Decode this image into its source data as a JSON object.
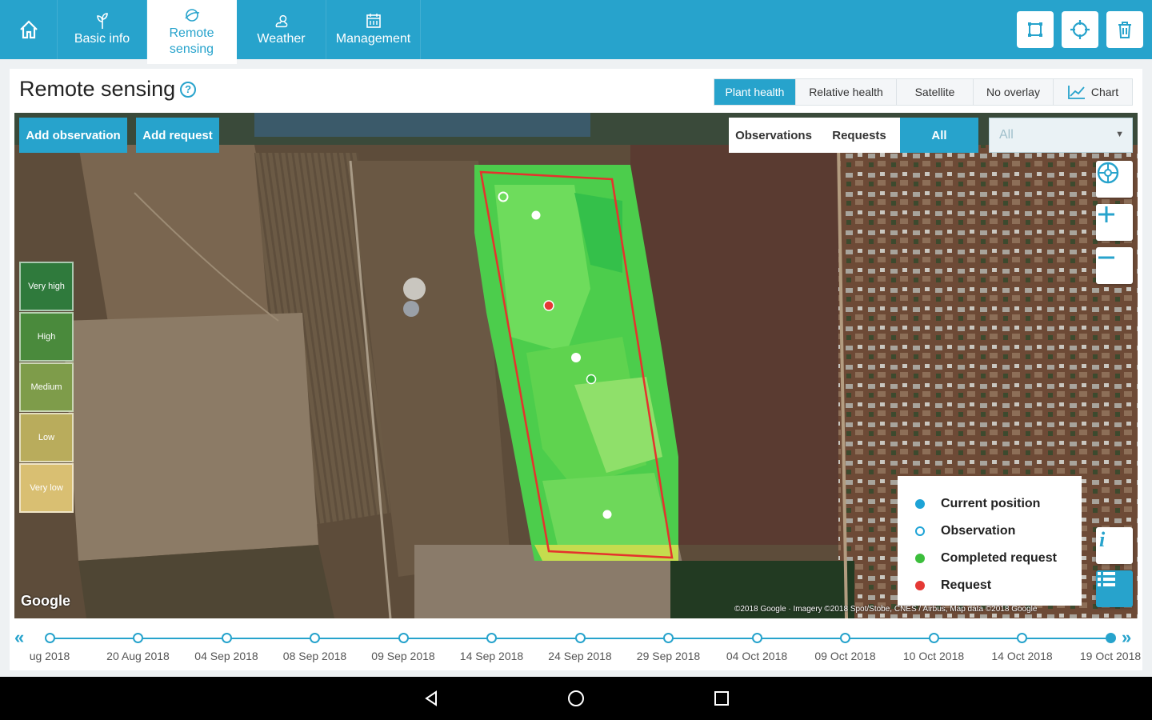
{
  "nav": {
    "tabs": [
      {
        "label_line1": "Basic info",
        "label_line2": ""
      },
      {
        "label_line1": "Remote",
        "label_line2": "sensing"
      },
      {
        "label_line1": "Weather",
        "label_line2": ""
      },
      {
        "label_line1": "Management",
        "label_line2": ""
      }
    ]
  },
  "page": {
    "title": "Remote sensing",
    "help": "?"
  },
  "overlay_tabs": [
    "Plant health",
    "Relative health",
    "Satellite",
    "No overlay",
    "Chart"
  ],
  "map": {
    "add_observation": "Add observation",
    "add_request": "Add request",
    "filter_tabs": [
      "Observations",
      "Requests",
      "All"
    ],
    "select_value": "All",
    "scale": [
      "Very high",
      "High",
      "Medium",
      "Low",
      "Very low"
    ],
    "legend": [
      {
        "label": "Current position",
        "color": "#1ea3d6"
      },
      {
        "label": "Observation",
        "color": "#ffffff"
      },
      {
        "label": "Completed request",
        "color": "#3cbe3c"
      },
      {
        "label": "Request",
        "color": "#e53935"
      }
    ],
    "google": "Google",
    "attribution": "©2018 Google · Imagery ©2018 Spot/Stobe, CNES / Airbus, Map data ©2018 Google"
  },
  "timeline": {
    "dates": [
      "ug 2018",
      "20 Aug 2018",
      "04 Sep 2018",
      "08 Sep 2018",
      "09 Sep 2018",
      "14 Sep 2018",
      "24 Sep 2018",
      "29 Sep 2018",
      "04 Oct 2018",
      "09 Oct 2018",
      "10 Oct 2018",
      "14 Oct 2018",
      "19 Oct 2018"
    ],
    "prev": "«",
    "next": "»"
  },
  "colors": {
    "accent": "#27a3cc"
  }
}
